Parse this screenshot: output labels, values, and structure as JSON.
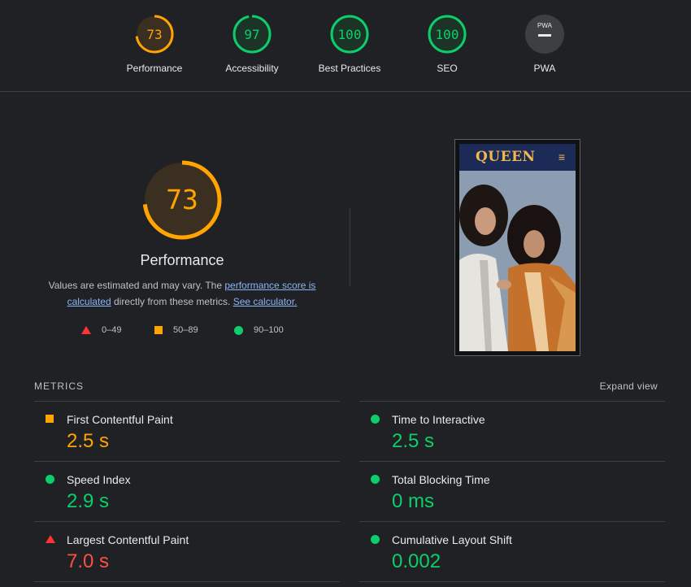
{
  "summary": [
    {
      "label": "Performance",
      "score": "73",
      "status": "average"
    },
    {
      "label": "Accessibility",
      "score": "97",
      "status": "pass"
    },
    {
      "label": "Best Practices",
      "score": "100",
      "status": "pass"
    },
    {
      "label": "SEO",
      "score": "100",
      "status": "pass"
    },
    {
      "label": "PWA",
      "badge": "PWA",
      "status": "na"
    }
  ],
  "performance": {
    "score": "73",
    "title": "Performance",
    "desc_prefix": "Values are estimated and may vary. The ",
    "desc_link1": "performance score is calculated",
    "desc_middle": " directly from these metrics. ",
    "desc_link2": "See calculator."
  },
  "legend": {
    "fail": "0–49",
    "average": "50–89",
    "pass": "90–100"
  },
  "screenshot": {
    "logo": "QUEEN",
    "menu_glyph": "≡"
  },
  "metrics": {
    "heading": "METRICS",
    "expand": "Expand view",
    "items": [
      {
        "title": "First Contentful Paint",
        "value": "2.5 s",
        "status": "average"
      },
      {
        "title": "Time to Interactive",
        "value": "2.5 s",
        "status": "pass"
      },
      {
        "title": "Speed Index",
        "value": "2.9 s",
        "status": "pass"
      },
      {
        "title": "Total Blocking Time",
        "value": "0 ms",
        "status": "pass"
      },
      {
        "title": "Largest Contentful Paint",
        "value": "7.0 s",
        "status": "fail"
      },
      {
        "title": "Cumulative Layout Shift",
        "value": "0.002",
        "status": "pass"
      }
    ]
  },
  "colors": {
    "pass": "#0cce6b",
    "average": "#ffa400",
    "fail": "#ff4e42",
    "background": "#202124"
  }
}
